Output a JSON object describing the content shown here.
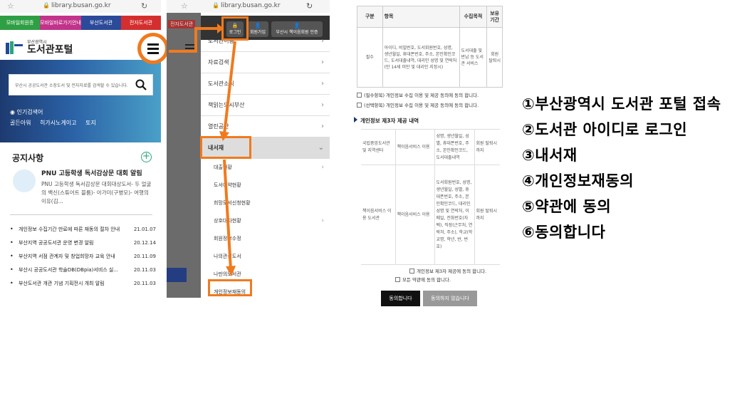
{
  "panel1": {
    "url": "library.busan.go.kr",
    "topnav": [
      {
        "label": "모바일회원증",
        "color": "#2e9f44"
      },
      {
        "label": "모바일바로가기안내",
        "color": "#c2338a"
      },
      {
        "label": "부산도서관",
        "color": "#2c4a9a"
      },
      {
        "label": "전자도서관",
        "color": "#d42f2f"
      }
    ],
    "brand_sub": "부산광역시",
    "brand_main": "도서관포털",
    "search_placeholder": "부산시 공공도서관 소장도서 및 전자자료를 검색할 수 있습니다.",
    "popular_label": "인기검색어",
    "popular_keywords": [
      "골든아워",
      "히가시노게이고",
      "토지"
    ],
    "notice_title": "공지사항",
    "feature_title": "PNU 고등학생 독서감상문 대회 알림",
    "feature_body": "PNU 고등학생 독서감상문 대회대상도서- 두 얼굴의 백신(스튜어트 블룸)- 아가미(구병모)- 여행의 이유(김...",
    "notices": [
      {
        "title": "개인정보 수집기간 만료에 따른 재동의 절차 안내",
        "date": "21.01.07"
      },
      {
        "title": "부산지역 공공도서관 운영 변경 알림",
        "date": "20.12.14"
      },
      {
        "title": "부산지역 서점 관계자 및 창업희망자 교육 안내",
        "date": "20.11.09"
      },
      {
        "title": "부산시 공공도서관 학술DB(DBpia)서비스 실...",
        "date": "20.11.03"
      },
      {
        "title": "부산도서관 개관 기념 기획전시 개최 알림",
        "date": "20.11.03"
      }
    ]
  },
  "panel2": {
    "url": "library.busan.go.kr",
    "side_label": "전자도서관",
    "buttons": {
      "login": "로그인",
      "join": "회원가입",
      "verify": "부산시 책이음회원 인증"
    },
    "menu": [
      "도서관이용",
      "자료검색",
      "도서관소식",
      "책읽는도시부산",
      "열린공간"
    ],
    "open_menu": "내서재",
    "submenu": [
      "대출현황",
      "도서예약현황",
      "희망도서신청현황",
      "상호대차현황",
      "회원정보수정",
      "나의관심도서",
      "나만의도서관",
      "개인정보재동의"
    ]
  },
  "panel3": {
    "table_headers": [
      "구분",
      "항목",
      "수집목적",
      "보유기간"
    ],
    "table_row": {
      "type": "필수",
      "items": "아이디, 비밀번호, 도서회원번호, 성명, 생년월일, 휴대폰번호, 주소, 본인확인코드, 도서대출내역, 대리인 성명 및 연락처(만 14세 미만 및 대리인 지정시)",
      "purpose": "도서대출 및 반납 등 도서관 서비스",
      "period": "회원 탈퇴시"
    },
    "agree_required": "(필수항목) 개인정보 수집 이용 및 제공 동의에 동의 합니다.",
    "agree_optional": "(선택항목) 개인정보 수집 이용 및 제공 동의에 동의 합니다.",
    "third_party_title": "개인정보 제3자 제공 내역",
    "third_rows": [
      {
        "org": "국립중앙도서관 및 지역센터",
        "purpose": "책이음서비스 이용",
        "items": "성명, 생년월일, 성별, 휴대폰번호, 주소, 본인확인코드, 도서대출내역",
        "period": "회원 탈퇴시까지"
      },
      {
        "org": "책이음서비스 이용 도서관",
        "purpose": "책이음서비스 이용",
        "items": "도서회원번호, 성명, 생년월일, 성별, 휴대폰번호, 주소, 본인확인코드, 대리인 성명 및 연락처, 이메일, 전화번호(자택), 직장(근무처, 연락처, 주소), 학교(학교명, 학년, 반, 번호)",
        "period": "회원 탈퇴시까지"
      }
    ],
    "agree_third": "개인정보 제3자 제공에 동의 합니다.",
    "agree_all": "모든 약관에 동의 합니다.",
    "btn_agree": "동의합니다",
    "btn_disagree": "동의하지 않습니다"
  },
  "steps": [
    "①부산광역시 도서관 포털 접속",
    "②도서관 아이디로 로그인",
    "③내서재",
    "④개인정보재동의",
    "⑤약관에 동의",
    "⑥동의합니다"
  ],
  "colors": {
    "highlight": "#f07a1e",
    "hero_dark": "#1d3a70"
  }
}
